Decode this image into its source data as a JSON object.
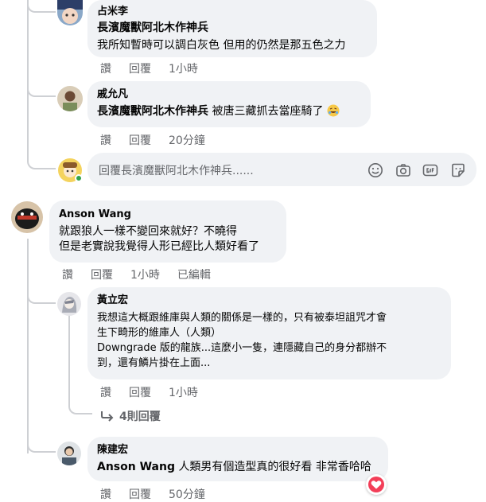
{
  "comments": [
    {
      "author": "占米李",
      "tag": "長濱魔獸阿北木作神兵",
      "text": "我所知暫時可以調白灰色 但用的仍然是那五色之力",
      "like_label": "讚",
      "reply_label": "回覆",
      "time": "1小時"
    },
    {
      "author": "戚允凡",
      "tag": "長濱魔獸阿北木作神兵",
      "text": "被唐三藏抓去當座騎了",
      "emoji": "rolling-on-floor-laughing",
      "like_label": "讚",
      "reply_label": "回覆",
      "time": "20分鐘"
    },
    {
      "author": "Anson Wang",
      "lines": [
        "就跟狼人一樣不變回來就好？不曉得",
        "但是老實說我覺得人形已經比人類好看了"
      ],
      "like_label": "讚",
      "reply_label": "回覆",
      "time": "1小時",
      "edited": "已編輯"
    },
    {
      "author": "黃立宏",
      "lines": [
        "我想這大概跟維庫與人類的關係是一樣的，只有被泰坦詛咒才會",
        "生下畸形的維庫人（人類）",
        "Downgrade 版的龍族...這麼小一隻，連隱藏自己的身分都辦不",
        "到，還有鱗片掛在上面..."
      ],
      "like_label": "讚",
      "reply_label": "回覆",
      "time": "1小時"
    },
    {
      "author": "陳建宏",
      "tag": "Anson Wang",
      "text": "人類男有個造型真的很好看 非常香哈哈",
      "like_label": "讚",
      "reply_label": "回覆",
      "time": "50分鐘"
    }
  ],
  "reply_box": {
    "placeholder": "回覆長濱魔獸阿北木作神兵......",
    "icons": [
      "emoji-icon",
      "camera-icon",
      "gif-icon",
      "sticker-icon"
    ]
  },
  "more_replies": "4則回覆",
  "colors": {
    "bubble": "#f0f2f5",
    "secondary_text": "#65676b",
    "thread_line": "#ced0d4",
    "reaction_heart": "#f33e58",
    "online_dot": "#31a24c"
  }
}
